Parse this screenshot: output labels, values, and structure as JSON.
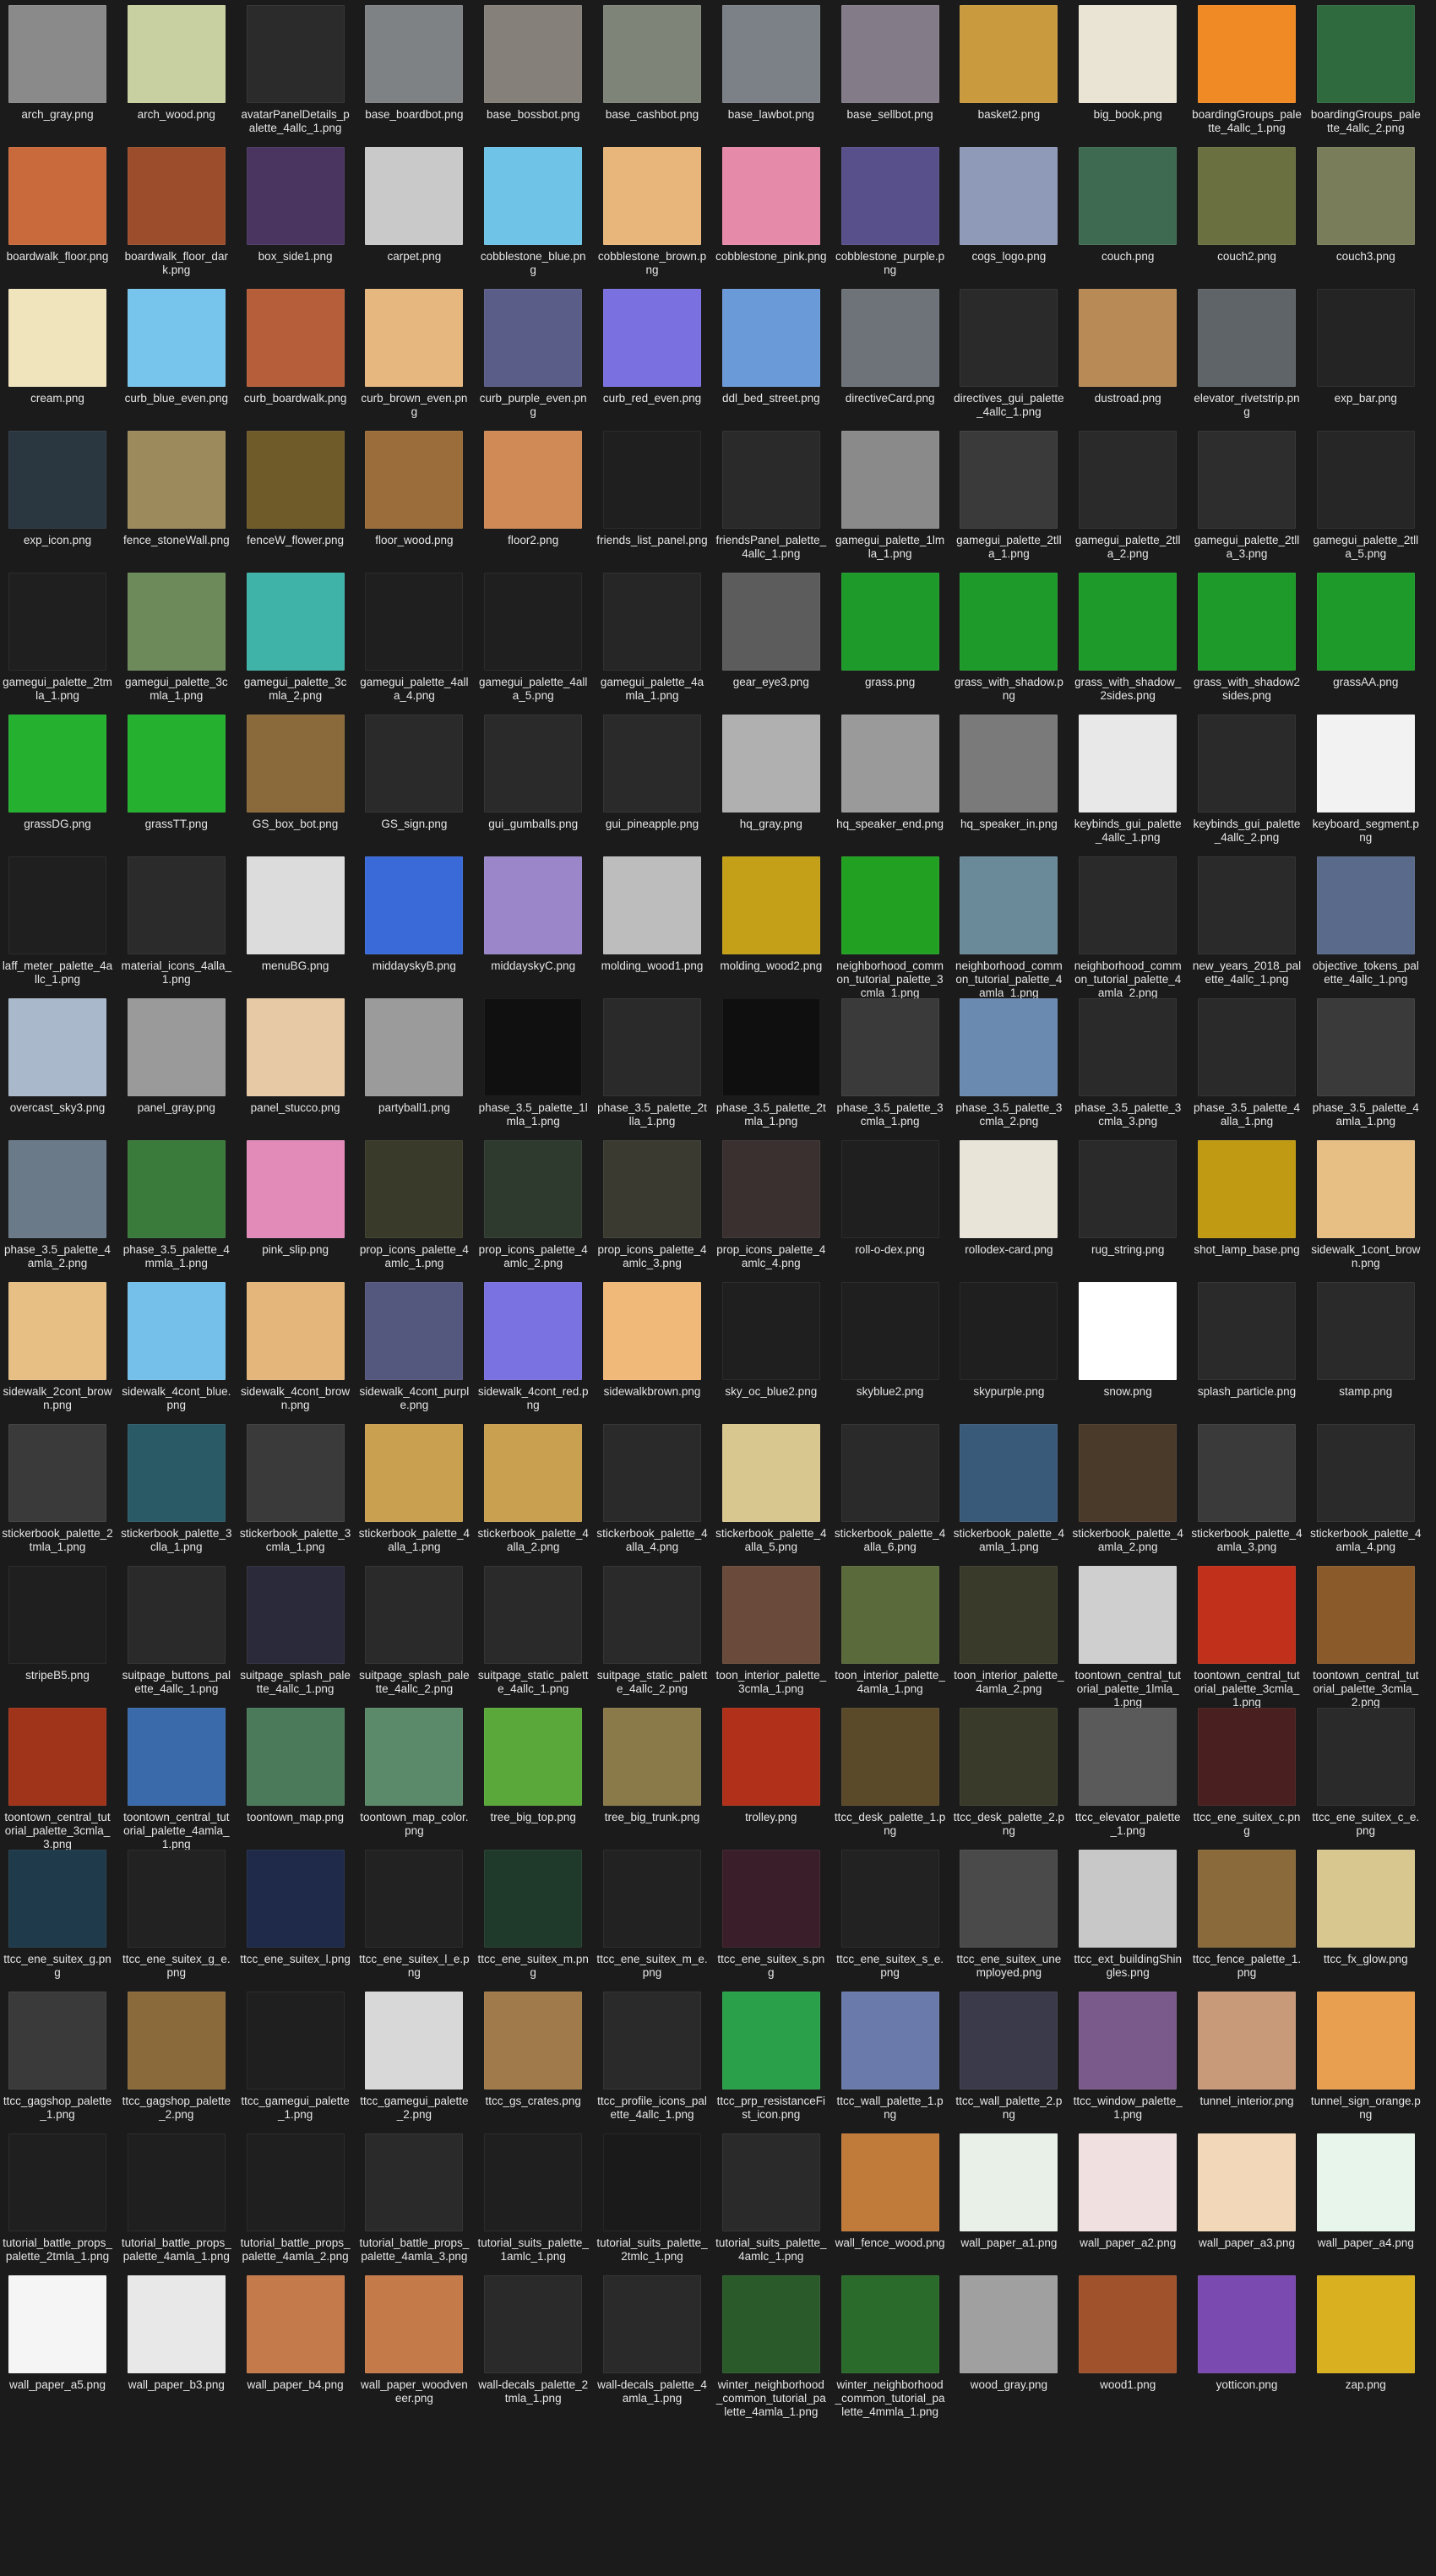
{
  "window": {
    "title": ""
  },
  "files": [
    {
      "name": "arch_gray.png",
      "bg": "#8a8a8a"
    },
    {
      "name": "arch_wood.png",
      "bg": "#c8cfa0"
    },
    {
      "name": "avatarPanelDetails_palette_4allc_1.png",
      "bg": "#2b2b2b"
    },
    {
      "name": "base_boardbot.png",
      "bg": "#7e8285"
    },
    {
      "name": "base_bossbot.png",
      "bg": "#85807a"
    },
    {
      "name": "base_cashbot.png",
      "bg": "#7f8478"
    },
    {
      "name": "base_lawbot.png",
      "bg": "#7b8187"
    },
    {
      "name": "base_sellbot.png",
      "bg": "#837c88"
    },
    {
      "name": "basket2.png",
      "bg": "#c99a3e"
    },
    {
      "name": "big_book.png",
      "bg": "#e9e4d3"
    },
    {
      "name": "boardingGroups_palette_4allc_1.png",
      "bg": "#ef8a25"
    },
    {
      "name": "boardingGroups_palette_4allc_2.png",
      "bg": "#2f6a3f"
    },
    {
      "name": "boardwalk_floor.png",
      "bg": "#c96a3c"
    },
    {
      "name": "boardwalk_floor_dark.png",
      "bg": "#9c4e2c"
    },
    {
      "name": "box_side1.png",
      "bg": "#4a3560"
    },
    {
      "name": "carpet.png",
      "bg": "#c9c9c9"
    },
    {
      "name": "cobblestone_blue.png",
      "bg": "#6ec3e6"
    },
    {
      "name": "cobblestone_brown.png",
      "bg": "#e8b67a"
    },
    {
      "name": "cobblestone_pink.png",
      "bg": "#e58aa8"
    },
    {
      "name": "cobblestone_purple.png",
      "bg": "#57508a"
    },
    {
      "name": "cogs_logo.png",
      "bg": "#8f9ab8"
    },
    {
      "name": "couch.png",
      "bg": "#3f6a52"
    },
    {
      "name": "couch2.png",
      "bg": "#6b7040"
    },
    {
      "name": "couch3.png",
      "bg": "#7a7d5a"
    },
    {
      "name": "cream.png",
      "bg": "#f0e4bc"
    },
    {
      "name": "curb_blue_even.png",
      "bg": "#77c4ec"
    },
    {
      "name": "curb_boardwalk.png",
      "bg": "#b65e3a"
    },
    {
      "name": "curb_brown_even.png",
      "bg": "#e6b77f"
    },
    {
      "name": "curb_purple_even.png",
      "bg": "#5a5d88"
    },
    {
      "name": "curb_red_even.png",
      "bg": "#7a70e0"
    },
    {
      "name": "ddl_bed_street.png",
      "bg": "#6a9ad8"
    },
    {
      "name": "directiveCard.png",
      "bg": "#6d7378"
    },
    {
      "name": "directives_gui_palette_4allc_1.png",
      "bg": "#2a2a2a"
    },
    {
      "name": "dustroad.png",
      "bg": "#b88a56"
    },
    {
      "name": "elevator_rivetstrip.png",
      "bg": "#5f6468"
    },
    {
      "name": "exp_bar.png",
      "bg": "#242424"
    },
    {
      "name": "exp_icon.png",
      "bg": "#2a3640"
    },
    {
      "name": "fence_stoneWall.png",
      "bg": "#9d8a5c"
    },
    {
      "name": "fenceW_flower.png",
      "bg": "#6f5a2a"
    },
    {
      "name": "floor_wood.png",
      "bg": "#9b6d3a"
    },
    {
      "name": "floor2.png",
      "bg": "#d08a55"
    },
    {
      "name": "friends_list_panel.png",
      "bg": "#1f1f1f"
    },
    {
      "name": "friendsPanel_palette_4allc_1.png",
      "bg": "#2a2a2a"
    },
    {
      "name": "gamegui_palette_1lmla_1.png",
      "bg": "#8a8a8a"
    },
    {
      "name": "gamegui_palette_2tlla_1.png",
      "bg": "#3a3a3a"
    },
    {
      "name": "gamegui_palette_2tlla_2.png",
      "bg": "#2a2a2a"
    },
    {
      "name": "gamegui_palette_2tlla_3.png",
      "bg": "#2d2d2d"
    },
    {
      "name": "gamegui_palette_2tlla_5.png",
      "bg": "#262626"
    },
    {
      "name": "gamegui_palette_2tmla_1.png",
      "bg": "#1f1f1f"
    },
    {
      "name": "gamegui_palette_3cmla_1.png",
      "bg": "#6c8a5a"
    },
    {
      "name": "gamegui_palette_3cmla_2.png",
      "bg": "#3fb3a8"
    },
    {
      "name": "gamegui_palette_4alla_4.png",
      "bg": "#1f1f1f"
    },
    {
      "name": "gamegui_palette_4alla_5.png",
      "bg": "#1f1f1f"
    },
    {
      "name": "gamegui_palette_4amla_1.png",
      "bg": "#262626"
    },
    {
      "name": "gear_eye3.png",
      "bg": "#5c5c5c"
    },
    {
      "name": "grass.png",
      "bg": "#1e9a2a"
    },
    {
      "name": "grass_with_shadow.png",
      "bg": "#1e9a2a"
    },
    {
      "name": "grass_with_shadow_2sides.png",
      "bg": "#1e9a2a"
    },
    {
      "name": "grass_with_shadow2sides.png",
      "bg": "#1e9a2a"
    },
    {
      "name": "grassAA.png",
      "bg": "#1e9a2a"
    },
    {
      "name": "grassDG.png",
      "bg": "#25b030"
    },
    {
      "name": "grassTT.png",
      "bg": "#25b030"
    },
    {
      "name": "GS_box_bot.png",
      "bg": "#8a6a3a"
    },
    {
      "name": "GS_sign.png",
      "bg": "#2a2a2a"
    },
    {
      "name": "gui_gumballs.png",
      "bg": "#2a2a2a"
    },
    {
      "name": "gui_pineapple.png",
      "bg": "#2a2a2a"
    },
    {
      "name": "hq_gray.png",
      "bg": "#b0b0b0"
    },
    {
      "name": "hq_speaker_end.png",
      "bg": "#9a9a9a"
    },
    {
      "name": "hq_speaker_in.png",
      "bg": "#7a7a7a"
    },
    {
      "name": "keybinds_gui_palette_4allc_1.png",
      "bg": "#e8e8e8"
    },
    {
      "name": "keybinds_gui_palette_4allc_2.png",
      "bg": "#2a2a2a"
    },
    {
      "name": "keyboard_segment.png",
      "bg": "#f2f2f2"
    },
    {
      "name": "laff_meter_palette_4allc_1.png",
      "bg": "#1f1f1f"
    },
    {
      "name": "material_icons_4alla_1.png",
      "bg": "#2b2b2b"
    },
    {
      "name": "menuBG.png",
      "bg": "#dcdcdc"
    },
    {
      "name": "middayskyB.png",
      "bg": "#3a6ad8"
    },
    {
      "name": "middayskyC.png",
      "bg": "#9a86c8"
    },
    {
      "name": "molding_wood1.png",
      "bg": "#bdbdbd"
    },
    {
      "name": "molding_wood2.png",
      "bg": "#c4a018"
    },
    {
      "name": "neighborhood_common_tutorial_palette_3cmla_1.png",
      "bg": "#22a022"
    },
    {
      "name": "neighborhood_common_tutorial_palette_4amla_1.png",
      "bg": "#6a8a9a"
    },
    {
      "name": "neighborhood_common_tutorial_palette_4amla_2.png",
      "bg": "#2a2a2a"
    },
    {
      "name": "new_years_2018_palette_4allc_1.png",
      "bg": "#2a2a2a"
    },
    {
      "name": "objective_tokens_palette_4allc_1.png",
      "bg": "#5a6a8a"
    },
    {
      "name": "overcast_sky3.png",
      "bg": "#aab8cc"
    },
    {
      "name": "panel_gray.png",
      "bg": "#9a9a9a"
    },
    {
      "name": "panel_stucco.png",
      "bg": "#e8c9a6"
    },
    {
      "name": "partyball1.png",
      "bg": "#9b9b9b"
    },
    {
      "name": "phase_3.5_palette_1lmla_1.png",
      "bg": "#101010"
    },
    {
      "name": "phase_3.5_palette_2tlla_1.png",
      "bg": "#2a2a2a"
    },
    {
      "name": "phase_3.5_palette_2tmla_1.png",
      "bg": "#0f0f0f"
    },
    {
      "name": "phase_3.5_palette_3cmla_1.png",
      "bg": "#3a3a3a"
    },
    {
      "name": "phase_3.5_palette_3cmla_2.png",
      "bg": "#6a8ab0"
    },
    {
      "name": "phase_3.5_palette_3cmla_3.png",
      "bg": "#2a2a2a"
    },
    {
      "name": "phase_3.5_palette_4alla_1.png",
      "bg": "#2a2a2a"
    },
    {
      "name": "phase_3.5_palette_4amla_1.png",
      "bg": "#3a3a3a"
    },
    {
      "name": "phase_3.5_palette_4amla_2.png",
      "bg": "#6a7a88"
    },
    {
      "name": "phase_3.5_palette_4mmla_1.png",
      "bg": "#3a7a3a"
    },
    {
      "name": "pink_slip.png",
      "bg": "#e28bb8"
    },
    {
      "name": "prop_icons_palette_4amlc_1.png",
      "bg": "#3a3a2a"
    },
    {
      "name": "prop_icons_palette_4amlc_2.png",
      "bg": "#2f3a2f"
    },
    {
      "name": "prop_icons_palette_4amlc_3.png",
      "bg": "#3a3a30"
    },
    {
      "name": "prop_icons_palette_4amlc_4.png",
      "bg": "#3a3030"
    },
    {
      "name": "roll-o-dex.png",
      "bg": "#1f1f1f"
    },
    {
      "name": "rollodex-card.png",
      "bg": "#e8e4d8"
    },
    {
      "name": "rug_string.png",
      "bg": "#2a2a2a"
    },
    {
      "name": "shot_lamp_base.png",
      "bg": "#c09a12"
    },
    {
      "name": "sidewalk_1cont_brown.png",
      "bg": "#e7bf85"
    },
    {
      "name": "sidewalk_2cont_brown.png",
      "bg": "#e7bf85"
    },
    {
      "name": "sidewalk_4cont_blue.png",
      "bg": "#74c0ea"
    },
    {
      "name": "sidewalk_4cont_brown.png",
      "bg": "#e4b67c"
    },
    {
      "name": "sidewalk_4cont_purple.png",
      "bg": "#54577e"
    },
    {
      "name": "sidewalk_4cont_red.png",
      "bg": "#7a72e0"
    },
    {
      "name": "sidewalkbrown.png",
      "bg": "#f0b97a"
    },
    {
      "name": "sky_oc_blue2.png",
      "bg": "#1f1f1f"
    },
    {
      "name": "skyblue2.png",
      "bg": "#1f1f1f"
    },
    {
      "name": "skypurple.png",
      "bg": "#1f1f1f"
    },
    {
      "name": "snow.png",
      "bg": "#ffffff"
    },
    {
      "name": "splash_particle.png",
      "bg": "#2a2a2a"
    },
    {
      "name": "stamp.png",
      "bg": "#2a2a2a"
    },
    {
      "name": "stickerbook_palette_2tmla_1.png",
      "bg": "#3a3a3a"
    },
    {
      "name": "stickerbook_palette_3clla_1.png",
      "bg": "#2a5a66"
    },
    {
      "name": "stickerbook_palette_3cmla_1.png",
      "bg": "#3a3a3a"
    },
    {
      "name": "stickerbook_palette_4alla_1.png",
      "bg": "#c8a050"
    },
    {
      "name": "stickerbook_palette_4alla_2.png",
      "bg": "#c8a050"
    },
    {
      "name": "stickerbook_palette_4alla_4.png",
      "bg": "#2a2a2a"
    },
    {
      "name": "stickerbook_palette_4alla_5.png",
      "bg": "#d8c890"
    },
    {
      "name": "stickerbook_palette_4alla_6.png",
      "bg": "#2a2a2a"
    },
    {
      "name": "stickerbook_palette_4amla_1.png",
      "bg": "#3a5a7a"
    },
    {
      "name": "stickerbook_palette_4amla_2.png",
      "bg": "#4a3a2a"
    },
    {
      "name": "stickerbook_palette_4amla_3.png",
      "bg": "#3a3a3a"
    },
    {
      "name": "stickerbook_palette_4amla_4.png",
      "bg": "#2a2a2a"
    },
    {
      "name": "stripeB5.png",
      "bg": "#1f1f1f"
    },
    {
      "name": "suitpage_buttons_palette_4allc_1.png",
      "bg": "#2a2a2a"
    },
    {
      "name": "suitpage_splash_palette_4allc_1.png",
      "bg": "#2a2a3a"
    },
    {
      "name": "suitpage_splash_palette_4allc_2.png",
      "bg": "#2a2a2a"
    },
    {
      "name": "suitpage_static_palette_4allc_1.png",
      "bg": "#2a2a2a"
    },
    {
      "name": "suitpage_static_palette_4allc_2.png",
      "bg": "#2a2a2a"
    },
    {
      "name": "toon_interior_palette_3cmla_1.png",
      "bg": "#6a4a3a"
    },
    {
      "name": "toon_interior_palette_4amla_1.png",
      "bg": "#5a6a3a"
    },
    {
      "name": "toon_interior_palette_4amla_2.png",
      "bg": "#3a3a2a"
    },
    {
      "name": "toontown_central_tutorial_palette_1lmla_1.png",
      "bg": "#cfcfcf"
    },
    {
      "name": "toontown_central_tutorial_palette_3cmla_1.png",
      "bg": "#c0301a"
    },
    {
      "name": "toontown_central_tutorial_palette_3cmla_2.png",
      "bg": "#8a5a2a"
    },
    {
      "name": "toontown_central_tutorial_palette_3cmla_3.png",
      "bg": "#a0341a"
    },
    {
      "name": "toontown_central_tutorial_palette_4amla_1.png",
      "bg": "#3a6aaa"
    },
    {
      "name": "toontown_map.png",
      "bg": "#4a7a5a"
    },
    {
      "name": "toontown_map_color.png",
      "bg": "#5a8a6a"
    },
    {
      "name": "tree_big_top.png",
      "bg": "#5aa83a"
    },
    {
      "name": "tree_big_trunk.png",
      "bg": "#8a7a4a"
    },
    {
      "name": "trolley.png",
      "bg": "#b0301a"
    },
    {
      "name": "ttcc_desk_palette_1.png",
      "bg": "#5a4a2a"
    },
    {
      "name": "ttcc_desk_palette_2.png",
      "bg": "#3a3a2a"
    },
    {
      "name": "ttcc_elevator_palette_1.png",
      "bg": "#5a5a5a"
    },
    {
      "name": "ttcc_ene_suitex_c.png",
      "bg": "#4a1f1f"
    },
    {
      "name": "ttcc_ene_suitex_c_e.png",
      "bg": "#2a2a2a"
    },
    {
      "name": "ttcc_ene_suitex_g.png",
      "bg": "#1f3a4a"
    },
    {
      "name": "ttcc_ene_suitex_g_e.png",
      "bg": "#222222"
    },
    {
      "name": "ttcc_ene_suitex_l.png",
      "bg": "#1f2a4a"
    },
    {
      "name": "ttcc_ene_suitex_l_e.png",
      "bg": "#222222"
    },
    {
      "name": "ttcc_ene_suitex_m.png",
      "bg": "#1f3a2a"
    },
    {
      "name": "ttcc_ene_suitex_m_e.png",
      "bg": "#222222"
    },
    {
      "name": "ttcc_ene_suitex_s.png",
      "bg": "#3a1f2a"
    },
    {
      "name": "ttcc_ene_suitex_s_e.png",
      "bg": "#222222"
    },
    {
      "name": "ttcc_ene_suitex_unemployed.png",
      "bg": "#4a4a4a"
    },
    {
      "name": "ttcc_ext_buildingShingles.png",
      "bg": "#c8c8c8"
    },
    {
      "name": "ttcc_fence_palette_1.png",
      "bg": "#8a6a3a"
    },
    {
      "name": "ttcc_fx_glow.png",
      "bg": "#d8c890"
    },
    {
      "name": "ttcc_gagshop_palette_1.png",
      "bg": "#3a3a3a"
    },
    {
      "name": "ttcc_gagshop_palette_2.png",
      "bg": "#8a6a3a"
    },
    {
      "name": "ttcc_gamegui_palette_1.png",
      "bg": "#1f1f1f"
    },
    {
      "name": "ttcc_gamegui_palette_2.png",
      "bg": "#d8d8d8"
    },
    {
      "name": "ttcc_gs_crates.png",
      "bg": "#a07a4a"
    },
    {
      "name": "ttcc_profile_icons_palette_4allc_1.png",
      "bg": "#2a2a2a"
    },
    {
      "name": "ttcc_prp_resistanceFist_icon.png",
      "bg": "#2aa04a"
    },
    {
      "name": "ttcc_wall_palette_1.png",
      "bg": "#6a7aaa"
    },
    {
      "name": "ttcc_wall_palette_2.png",
      "bg": "#3a3a4a"
    },
    {
      "name": "ttcc_window_palette_1.png",
      "bg": "#7a5a8a"
    },
    {
      "name": "tunnel_interior.png",
      "bg": "#c89a7a"
    },
    {
      "name": "tunnel_sign_orange.png",
      "bg": "#e8a050"
    },
    {
      "name": "tutorial_battle_props_palette_2tmla_1.png",
      "bg": "#1f1f1f"
    },
    {
      "name": "tutorial_battle_props_palette_4amla_1.png",
      "bg": "#1f1f1f"
    },
    {
      "name": "tutorial_battle_props_palette_4amla_2.png",
      "bg": "#1f1f1f"
    },
    {
      "name": "tutorial_battle_props_palette_4amla_3.png",
      "bg": "#2a2a2a"
    },
    {
      "name": "tutorial_suits_palette_1amlc_1.png",
      "bg": "#1f1f1f"
    },
    {
      "name": "tutorial_suits_palette_2tmlc_1.png",
      "bg": "#1a1a1a"
    },
    {
      "name": "tutorial_suits_palette_4amlc_1.png",
      "bg": "#2a2a2a"
    },
    {
      "name": "wall_fence_wood.png",
      "bg": "#c07a3a"
    },
    {
      "name": "wall_paper_a1.png",
      "bg": "#e8f0e8"
    },
    {
      "name": "wall_paper_a2.png",
      "bg": "#f0e0e0"
    },
    {
      "name": "wall_paper_a3.png",
      "bg": "#f2d8b8"
    },
    {
      "name": "wall_paper_a4.png",
      "bg": "#e8f5ea"
    },
    {
      "name": "wall_paper_a5.png",
      "bg": "#f5f5f5"
    },
    {
      "name": "wall_paper_b3.png",
      "bg": "#e8e8e8"
    },
    {
      "name": "wall_paper_b4.png",
      "bg": "#c47a4a"
    },
    {
      "name": "wall_paper_woodveneer.png",
      "bg": "#c57a4a"
    },
    {
      "name": "wall-decals_palette_2tmla_1.png",
      "bg": "#2a2a2a"
    },
    {
      "name": "wall-decals_palette_4amla_1.png",
      "bg": "#2a2a2a"
    },
    {
      "name": "winter_neighborhood_common_tutorial_palette_4amla_1.png",
      "bg": "#2a5a2a"
    },
    {
      "name": "winter_neighborhood_common_tutorial_palette_4mmla_1.png",
      "bg": "#2a6a2a"
    },
    {
      "name": "wood_gray.png",
      "bg": "#a0a0a0"
    },
    {
      "name": "wood1.png",
      "bg": "#a0522d"
    },
    {
      "name": "yotticon.png",
      "bg": "#7a4ab0"
    },
    {
      "name": "zap.png",
      "bg": "#d8b020"
    }
  ]
}
